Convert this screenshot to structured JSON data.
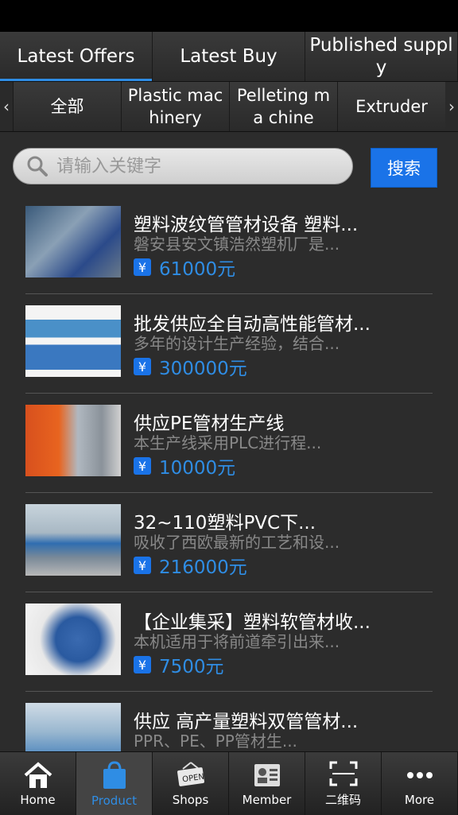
{
  "tabs": [
    {
      "label": "Latest Offers"
    },
    {
      "label": "Latest Buy"
    },
    {
      "label": "Published suppl y"
    }
  ],
  "categories": [
    {
      "label": "全部"
    },
    {
      "label": "Plastic mac hinery"
    },
    {
      "label": "Pelleting ma chine"
    },
    {
      "label": "Extruder"
    }
  ],
  "search": {
    "placeholder": "请输入关键字",
    "button_label": "搜索"
  },
  "products": [
    {
      "title": "塑料波纹管管材设备 塑料...",
      "desc": "磐安县安文镇浩然塑机厂是...",
      "price": "61000元"
    },
    {
      "title": "批发供应全自动高性能管材...",
      "desc": "多年的设计生产经验，结合...",
      "price": "300000元"
    },
    {
      "title": "供应PE管材生产线",
      "desc": "本生产线采用PLC进行程...",
      "price": "10000元"
    },
    {
      "title": "32~110塑料PVC下...",
      "desc": "吸收了西欧最新的工艺和设...",
      "price": "216000元"
    },
    {
      "title": "【企业集采】塑料软管材收...",
      "desc": "本机适用于将前道牵引出来...",
      "price": "7500元"
    },
    {
      "title": "供应 高产量塑料双管管材...",
      "desc": "PPR、PE、PP管材生...",
      "price": ""
    }
  ],
  "currency_symbol": "¥",
  "nav": [
    {
      "label": "Home",
      "icon": "home-icon"
    },
    {
      "label": "Product",
      "icon": "shopping-bag-icon"
    },
    {
      "label": "Shops",
      "icon": "open-sign-icon"
    },
    {
      "label": "Member",
      "icon": "id-card-icon"
    },
    {
      "label": "二维码",
      "icon": "qr-scan-icon"
    },
    {
      "label": "More",
      "icon": "more-icon"
    }
  ],
  "colors": {
    "accent": "#2f8de4",
    "button": "#1a73e8"
  }
}
